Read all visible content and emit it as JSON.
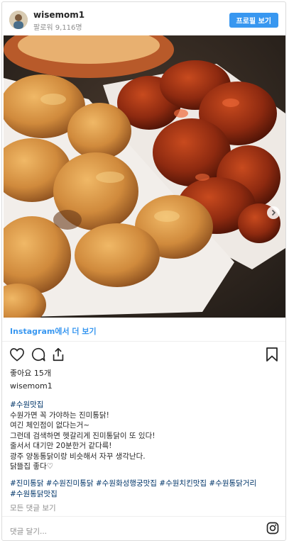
{
  "header": {
    "username": "wisemom1",
    "followers": "팔로워 9,116명",
    "profile_button": "프로필 보기"
  },
  "post": {
    "image_alt": "fried chicken and sauced chicken",
    "carousel": {
      "total": 6,
      "active": 0
    }
  },
  "more_link": "Instagram에서 더 보기",
  "actions": {
    "like_icon": "heart-icon",
    "comment_icon": "comment-icon",
    "share_icon": "share-icon",
    "save_icon": "bookmark-icon"
  },
  "likes": "좋아요 15개",
  "caption_user": "wisemom1",
  "caption": {
    "hashtag": "#수원맛집",
    "lines": [
      "수원가면 꼭 가야하는 진미통닭!",
      "여긴 체인점이 없다는거~",
      "그런데 검색하면 헷갈리게 진미통닭이 또 있다!",
      "줄서서 대기만 20분한거 같다륵!",
      "광주 양동통닭이랑 비슷해서 자꾸 생각난다.",
      "닭뜰집 좋다♡"
    ]
  },
  "hashtags_line1": "#진미통닭 #수원진미통닭 #수원화성행궁맛집 #수원치킨맛집 #수원통닭거리",
  "hashtags_line2": "#수원통닭맛집",
  "all_comments": "모든 댓글 보기",
  "comment_placeholder": "댓글 달기...",
  "colors": {
    "accent": "#3897f0",
    "hashtag": "#003569",
    "muted": "#8e8e8e"
  }
}
